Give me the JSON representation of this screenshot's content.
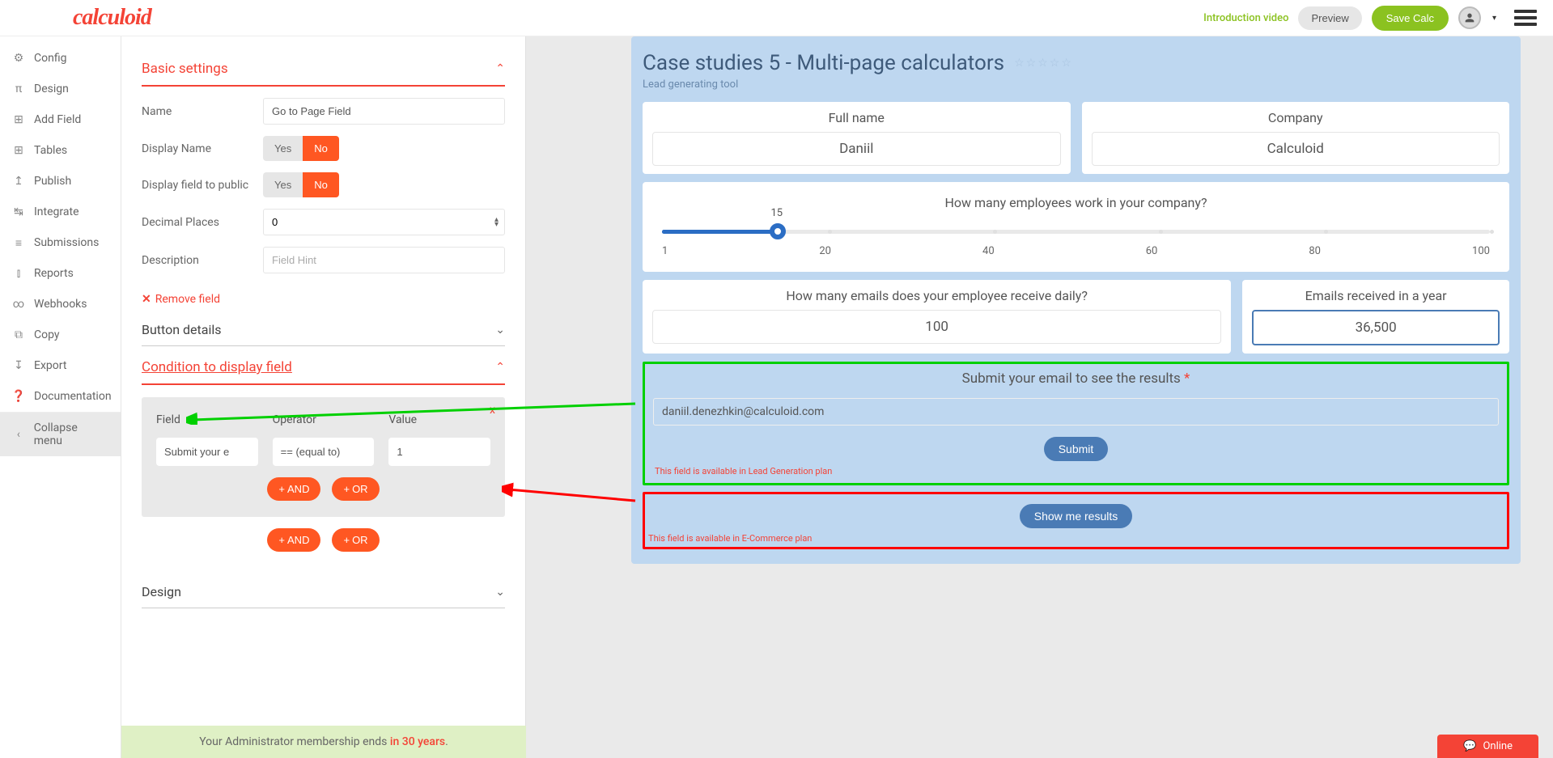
{
  "header": {
    "logo": "calculoid",
    "intro_link": "Introduction video",
    "preview_btn": "Preview",
    "save_btn": "Save Calc"
  },
  "sidebar": {
    "items": [
      {
        "icon": "gear",
        "label": "Config"
      },
      {
        "icon": "design",
        "label": "Design"
      },
      {
        "icon": "plus",
        "label": "Add Field"
      },
      {
        "icon": "table",
        "label": "Tables"
      },
      {
        "icon": "publish",
        "label": "Publish"
      },
      {
        "icon": "integrate",
        "label": "Integrate"
      },
      {
        "icon": "submissions",
        "label": "Submissions"
      },
      {
        "icon": "reports",
        "label": "Reports"
      },
      {
        "icon": "webhooks",
        "label": "Webhooks"
      },
      {
        "icon": "copy",
        "label": "Copy"
      },
      {
        "icon": "export",
        "label": "Export"
      },
      {
        "icon": "docs",
        "label": "Documentation"
      },
      {
        "icon": "collapse",
        "label": "Collapse menu"
      }
    ]
  },
  "settings": {
    "section_basic": "Basic settings",
    "name_label": "Name",
    "name_value": "Go to Page Field",
    "display_name_label": "Display Name",
    "display_public_label": "Display field to public",
    "yes": "Yes",
    "no": "No",
    "decimal_label": "Decimal Places",
    "decimal_value": "0",
    "description_label": "Description",
    "description_placeholder": "Field Hint",
    "remove_field": "Remove field",
    "section_button": "Button details",
    "section_condition": "Condition to display field",
    "cond_field_label": "Field",
    "cond_operator_label": "Operator",
    "cond_value_label": "Value",
    "cond_field_value": "Submit your e",
    "cond_operator_value": "== (equal to)",
    "cond_value_value": "1",
    "and_btn": "AND",
    "or_btn": "OR",
    "section_design": "Design"
  },
  "calc": {
    "title": "Case studies 5 - Multi-page calculators",
    "subtitle": "Lead generating tool",
    "fullname_label": "Full name",
    "fullname_value": "Daniil",
    "company_label": "Company",
    "company_value": "Calculoid",
    "employees_q": "How many employees work in your company?",
    "slider_value": "15",
    "slider_ticks": [
      "1",
      "20",
      "40",
      "60",
      "80",
      "100"
    ],
    "emails_daily_label": "How many emails does your employee receive daily?",
    "emails_daily_value": "100",
    "emails_year_label": "Emails received in a year",
    "emails_year_value": "36,500",
    "submit_title": "Submit your email to see the results",
    "email_value": "daniil.denezhkin@calculoid.com",
    "submit_btn": "Submit",
    "leadgen_note": "This field is available in Lead Generation plan",
    "show_results_btn": "Show me results",
    "ecom_note": "This field is available in E-Commerce plan"
  },
  "footer": {
    "text_a": "Your Administrator membership ends ",
    "text_b": "in 30 years",
    "text_c": "."
  },
  "chat": {
    "label": "Online"
  }
}
